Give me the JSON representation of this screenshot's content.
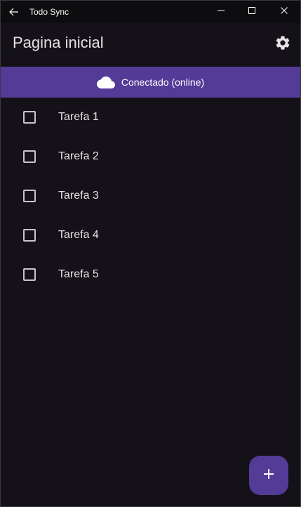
{
  "window": {
    "title": "Todo Sync",
    "controls": {
      "back_icon": "arrow-left-icon",
      "minimize_icon": "minimize-icon",
      "maximize_icon": "maximize-icon",
      "close_icon": "close-icon"
    }
  },
  "appbar": {
    "title": "Pagina inicial",
    "settings_icon": "gear-icon"
  },
  "status": {
    "icon": "cloud-icon",
    "text": "Conectado (online)",
    "color": "#533b97"
  },
  "tasks": [
    {
      "label": "Tarefa 1",
      "checked": false
    },
    {
      "label": "Tarefa 2",
      "checked": false
    },
    {
      "label": "Tarefa 3",
      "checked": false
    },
    {
      "label": "Tarefa 4",
      "checked": false
    },
    {
      "label": "Tarefa 5",
      "checked": false
    }
  ],
  "fab": {
    "icon": "plus-icon"
  },
  "colors": {
    "accent": "#533b97",
    "background": "#141218",
    "titlebar": "#0d0d0f",
    "text": "#e6e1e5"
  }
}
